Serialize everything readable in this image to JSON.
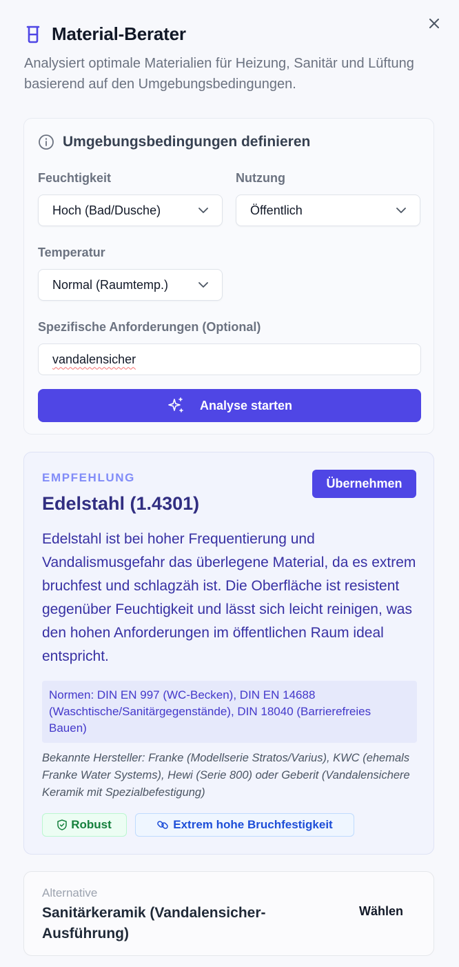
{
  "header": {
    "title": "Material-Berater",
    "subtitle": "Analysiert optimale Materialien für Heizung, Sanitär und Lüftung basierend auf den Umgebungsbedingungen.",
    "title_icon": "test-tube-icon",
    "close_icon": "close-icon"
  },
  "conditions": {
    "heading": "Umgebungsbedingungen definieren",
    "humidity": {
      "label": "Feuchtigkeit",
      "value": "Hoch (Bad/Dusche)"
    },
    "usage": {
      "label": "Nutzung",
      "value": "Öffentlich"
    },
    "temperature": {
      "label": "Temperatur",
      "value": "Normal (Raumtemp.)"
    },
    "requirements": {
      "label": "Spezifische Anforderungen (Optional)",
      "value": "vandalensicher"
    },
    "analyse_button": "Analyse starten"
  },
  "recommendation": {
    "kicker": "EMPFEHLUNG",
    "material": "Edelstahl (1.4301)",
    "apply_button": "Übernehmen",
    "description": "Edelstahl ist bei hoher Frequentierung und Vandalismusgefahr das überlegene Material, da es extrem bruchfest und schlagzäh ist. Die Oberfläche ist resistent gegenüber Feuchtigkeit und lässt sich leicht reinigen, was den hohen Anforderungen im öffentlichen Raum ideal entspricht.",
    "norms": "Normen: DIN EN 997 (WC-Becken), DIN EN 14688 (Waschtische/Sanitärgegenstände), DIN 18040 (Barrierefreies Bauen)",
    "manufacturers": "Bekannte Hersteller: Franke (Modellserie Stratos/Varius), KWC (ehemals Franke Water Systems), Hewi (Serie 800) oder Geberit (Vandalensichere Keramik mit Spezialbefestigung)",
    "tags": [
      {
        "label": "Robust",
        "icon": "shield-icon",
        "color": "#15803d"
      },
      {
        "label": "Extrem hohe Bruchfestigkeit",
        "icon": "link-icon",
        "color": "#1d4ed8"
      }
    ]
  },
  "alternative": {
    "kicker": "Alternative",
    "material": "Sanitärkeramik (Vandalensicher-Ausführung)",
    "choose_button": "Wählen"
  },
  "colors": {
    "accent": "#4f46e5",
    "accent_dark": "#312e81",
    "background": "#f7f8fc"
  }
}
